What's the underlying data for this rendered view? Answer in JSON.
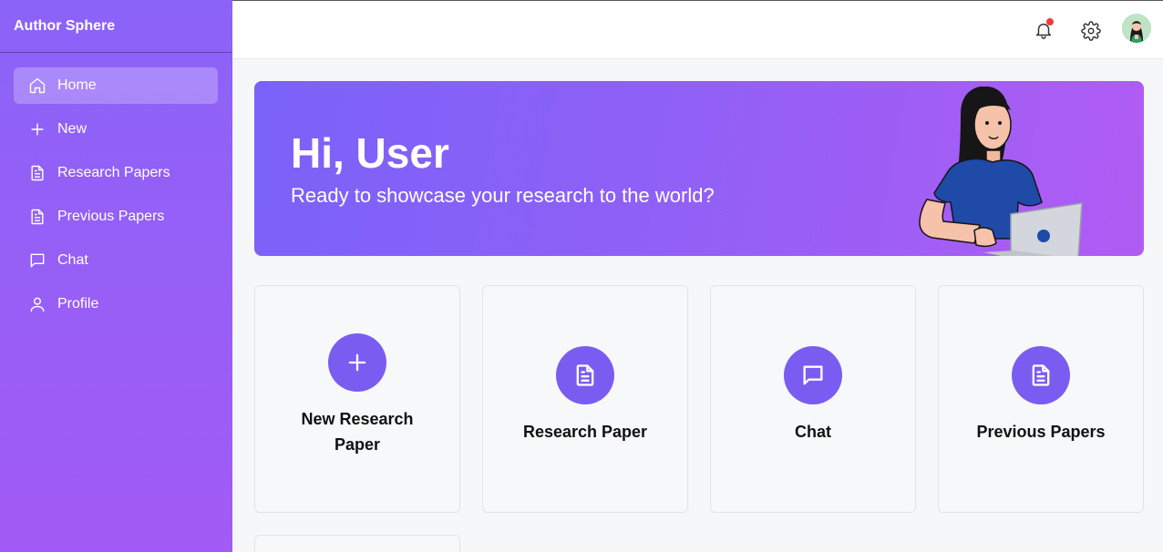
{
  "app": {
    "title": "Author Sphere"
  },
  "sidebar": {
    "items": [
      {
        "label": "Home",
        "icon": "home-icon"
      },
      {
        "label": "New",
        "icon": "plus-icon"
      },
      {
        "label": "Research Papers",
        "icon": "document-icon"
      },
      {
        "label": "Previous Papers",
        "icon": "document-icon"
      },
      {
        "label": "Chat",
        "icon": "chat-icon"
      },
      {
        "label": "Profile",
        "icon": "user-icon"
      }
    ]
  },
  "topbar": {
    "notification_icon": "bell-icon",
    "settings_icon": "gear-icon",
    "avatar": "user-avatar"
  },
  "banner": {
    "greeting": "Hi, User",
    "subtitle": "Ready to showcase your research to the world?"
  },
  "cards": [
    {
      "label": "New Research Paper",
      "icon": "plus-icon"
    },
    {
      "label": "Research Paper",
      "icon": "document-icon"
    },
    {
      "label": "Chat",
      "icon": "chat-icon"
    },
    {
      "label": "Previous Papers",
      "icon": "document-icon"
    }
  ],
  "colors": {
    "accent": "#7a5df0",
    "sidebar_top": "#8b63f8",
    "sidebar_bottom": "#a25bf5",
    "notification_dot": "#ef3b3b"
  }
}
